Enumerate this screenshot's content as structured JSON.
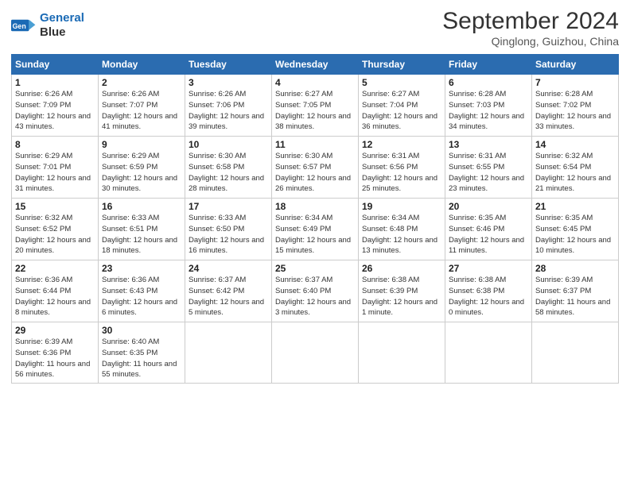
{
  "logo": {
    "line1": "General",
    "line2": "Blue"
  },
  "title": "September 2024",
  "location": "Qinglong, Guizhou, China",
  "weekdays": [
    "Sunday",
    "Monday",
    "Tuesday",
    "Wednesday",
    "Thursday",
    "Friday",
    "Saturday"
  ],
  "weeks": [
    [
      {
        "day": "1",
        "sunrise": "6:26 AM",
        "sunset": "7:09 PM",
        "daylight": "12 hours and 43 minutes."
      },
      {
        "day": "2",
        "sunrise": "6:26 AM",
        "sunset": "7:07 PM",
        "daylight": "12 hours and 41 minutes."
      },
      {
        "day": "3",
        "sunrise": "6:26 AM",
        "sunset": "7:06 PM",
        "daylight": "12 hours and 39 minutes."
      },
      {
        "day": "4",
        "sunrise": "6:27 AM",
        "sunset": "7:05 PM",
        "daylight": "12 hours and 38 minutes."
      },
      {
        "day": "5",
        "sunrise": "6:27 AM",
        "sunset": "7:04 PM",
        "daylight": "12 hours and 36 minutes."
      },
      {
        "day": "6",
        "sunrise": "6:28 AM",
        "sunset": "7:03 PM",
        "daylight": "12 hours and 34 minutes."
      },
      {
        "day": "7",
        "sunrise": "6:28 AM",
        "sunset": "7:02 PM",
        "daylight": "12 hours and 33 minutes."
      }
    ],
    [
      {
        "day": "8",
        "sunrise": "6:29 AM",
        "sunset": "7:01 PM",
        "daylight": "12 hours and 31 minutes."
      },
      {
        "day": "9",
        "sunrise": "6:29 AM",
        "sunset": "6:59 PM",
        "daylight": "12 hours and 30 minutes."
      },
      {
        "day": "10",
        "sunrise": "6:30 AM",
        "sunset": "6:58 PM",
        "daylight": "12 hours and 28 minutes."
      },
      {
        "day": "11",
        "sunrise": "6:30 AM",
        "sunset": "6:57 PM",
        "daylight": "12 hours and 26 minutes."
      },
      {
        "day": "12",
        "sunrise": "6:31 AM",
        "sunset": "6:56 PM",
        "daylight": "12 hours and 25 minutes."
      },
      {
        "day": "13",
        "sunrise": "6:31 AM",
        "sunset": "6:55 PM",
        "daylight": "12 hours and 23 minutes."
      },
      {
        "day": "14",
        "sunrise": "6:32 AM",
        "sunset": "6:54 PM",
        "daylight": "12 hours and 21 minutes."
      }
    ],
    [
      {
        "day": "15",
        "sunrise": "6:32 AM",
        "sunset": "6:52 PM",
        "daylight": "12 hours and 20 minutes."
      },
      {
        "day": "16",
        "sunrise": "6:33 AM",
        "sunset": "6:51 PM",
        "daylight": "12 hours and 18 minutes."
      },
      {
        "day": "17",
        "sunrise": "6:33 AM",
        "sunset": "6:50 PM",
        "daylight": "12 hours and 16 minutes."
      },
      {
        "day": "18",
        "sunrise": "6:34 AM",
        "sunset": "6:49 PM",
        "daylight": "12 hours and 15 minutes."
      },
      {
        "day": "19",
        "sunrise": "6:34 AM",
        "sunset": "6:48 PM",
        "daylight": "12 hours and 13 minutes."
      },
      {
        "day": "20",
        "sunrise": "6:35 AM",
        "sunset": "6:46 PM",
        "daylight": "12 hours and 11 minutes."
      },
      {
        "day": "21",
        "sunrise": "6:35 AM",
        "sunset": "6:45 PM",
        "daylight": "12 hours and 10 minutes."
      }
    ],
    [
      {
        "day": "22",
        "sunrise": "6:36 AM",
        "sunset": "6:44 PM",
        "daylight": "12 hours and 8 minutes."
      },
      {
        "day": "23",
        "sunrise": "6:36 AM",
        "sunset": "6:43 PM",
        "daylight": "12 hours and 6 minutes."
      },
      {
        "day": "24",
        "sunrise": "6:37 AM",
        "sunset": "6:42 PM",
        "daylight": "12 hours and 5 minutes."
      },
      {
        "day": "25",
        "sunrise": "6:37 AM",
        "sunset": "6:40 PM",
        "daylight": "12 hours and 3 minutes."
      },
      {
        "day": "26",
        "sunrise": "6:38 AM",
        "sunset": "6:39 PM",
        "daylight": "12 hours and 1 minute."
      },
      {
        "day": "27",
        "sunrise": "6:38 AM",
        "sunset": "6:38 PM",
        "daylight": "12 hours and 0 minutes."
      },
      {
        "day": "28",
        "sunrise": "6:39 AM",
        "sunset": "6:37 PM",
        "daylight": "11 hours and 58 minutes."
      }
    ],
    [
      {
        "day": "29",
        "sunrise": "6:39 AM",
        "sunset": "6:36 PM",
        "daylight": "11 hours and 56 minutes."
      },
      {
        "day": "30",
        "sunrise": "6:40 AM",
        "sunset": "6:35 PM",
        "daylight": "11 hours and 55 minutes."
      },
      null,
      null,
      null,
      null,
      null
    ]
  ],
  "labels": {
    "sunrise": "Sunrise:",
    "sunset": "Sunset:",
    "daylight": "Daylight:"
  }
}
